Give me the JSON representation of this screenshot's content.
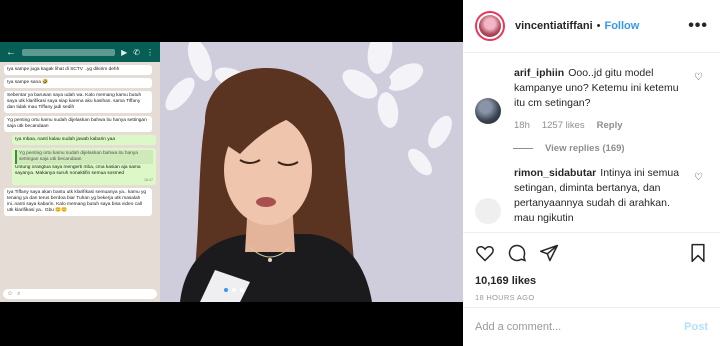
{
  "post": {
    "username": "vincentiatiffani",
    "separator": "•",
    "follow_label": "Follow",
    "more_label": "•••",
    "likes": "10,169 likes",
    "time": "18 HOURS AGO",
    "add_comment_placeholder": "Add a comment...",
    "post_label": "Post"
  },
  "comments": [
    {
      "user": "arif_iphiin",
      "text": "Ooo..jd gitu model kampanye uno? Ketemu ini ketemu itu cm setingan?",
      "age": "18h",
      "likes": "1257 likes",
      "reply": "Reply",
      "view_replies": "View replies (169)"
    },
    {
      "user": "rimon_sidabutar",
      "text": "Intinya ini semua setingan, diminta bertanya, dan pertanyaannya sudah di arahkan. mau ngikutin"
    }
  ],
  "chat": {
    "messages": [
      {
        "dir": "in",
        "quote": "",
        "text": "Iya sampe juga kagak lihat di SCTV ..yg dikirim dehh",
        "time": ""
      },
      {
        "dir": "in",
        "quote": "",
        "text": "Iya sampe sana 🤣",
        "time": ""
      },
      {
        "dir": "in",
        "quote": "",
        "text": "Sebentar ya barusan saya udah wa. Kalo memang kamu butuh saya utk klarifikasi saya siap karena aku kasihan. sama Tiffany dan tidak mau Tiffany jadi sedih",
        "time": ""
      },
      {
        "dir": "in",
        "quote": "",
        "text": "Yg penting ortu kamu sudah dijelaskan bahwa itu hanya settingan saja utk becandaan",
        "time": ""
      },
      {
        "dir": "out",
        "quote": "",
        "text": "Iya mbaa, nanti kalau sudah jawab kabarin yaa",
        "time": ""
      },
      {
        "dir": "out",
        "quote": "Yg penting ortu kamu sudah dijelaskan bahwa itu hanya settingan saja utk becandaan",
        "text": "Untung orangtua saya mengerti mba, cma kasian aja sama sayanya. Makanya suruh nonaktifin semua sosmed",
        "time": "16:47"
      },
      {
        "dir": "in",
        "quote": "",
        "text": "Iya Tiffany saya akan bantu utk klarifikasi semuanya ya.. kamu yg tenang ya dan terus berdoa biar Tuhan yg bekerja utk masalah ini..nanti saya kabarin. Kalo memang butuh saya bisa video call utk klarifikasi ya.. Gbu 😊😊",
        "time": ""
      }
    ]
  }
}
